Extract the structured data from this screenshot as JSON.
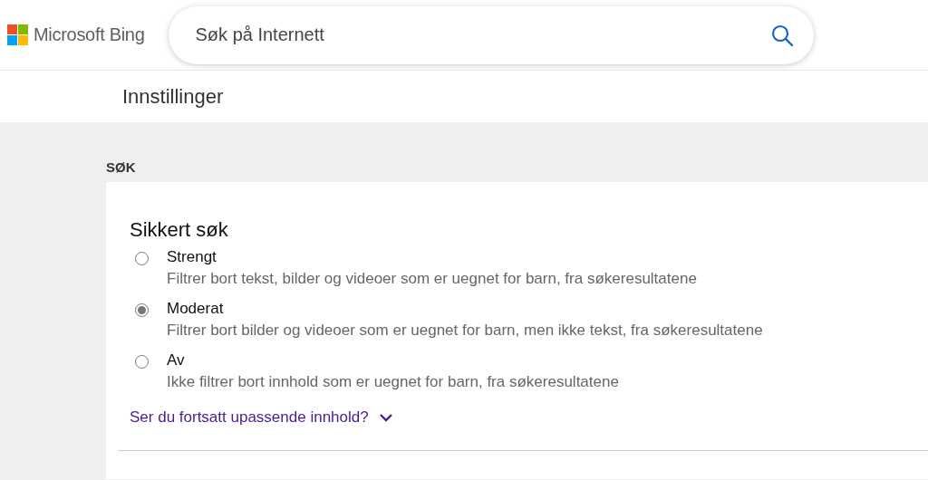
{
  "header": {
    "logo_text": "Microsoft Bing",
    "search": {
      "placeholder": "Søk på Internett"
    }
  },
  "page_title": "Innstillinger",
  "section": {
    "heading": "SØK",
    "card": {
      "title": "Sikkert søk",
      "options": [
        {
          "label": "Strengt",
          "description": "Filtrer bort tekst, bilder og videoer som er uegnet for barn, fra søkeresultatene",
          "selected": false
        },
        {
          "label": "Moderat",
          "description": "Filtrer bort bilder og videoer som er uegnet for barn, men ikke tekst, fra søkeresultatene",
          "selected": true
        },
        {
          "label": "Av",
          "description": "Ikke filtrer bort innhold som er uegnet for barn, fra søkeresultatene",
          "selected": false
        }
      ],
      "more_link": {
        "label": "Ser du fortsatt upassende innhold?",
        "expanded": false
      }
    }
  }
}
